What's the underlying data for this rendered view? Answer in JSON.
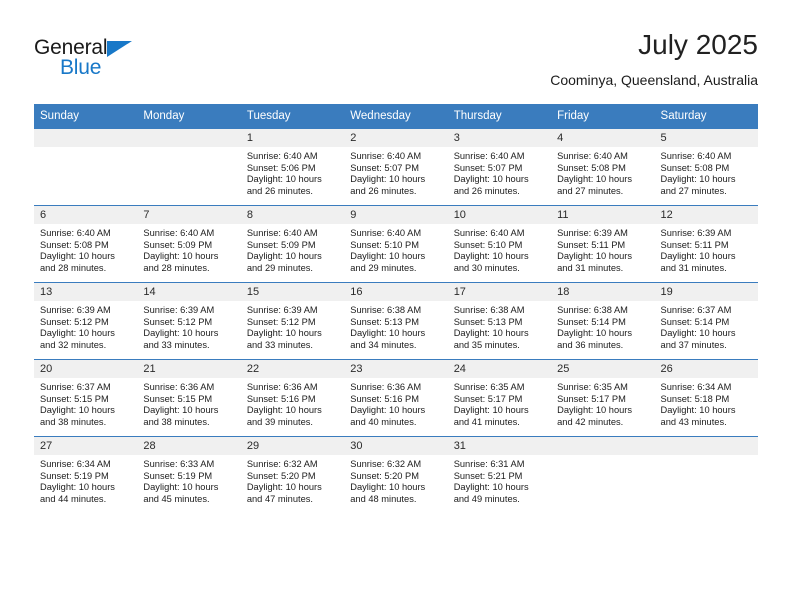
{
  "brand": {
    "name_line1": "General",
    "name_line2": "Blue",
    "accent_color": "#1878c8"
  },
  "header": {
    "month_title": "July 2025",
    "location": "Coominya, Queensland, Australia"
  },
  "calendar": {
    "header_bg": "#3a7cbe",
    "daynum_band_bg": "#f0f0f0",
    "weekday_headers": [
      "Sunday",
      "Monday",
      "Tuesday",
      "Wednesday",
      "Thursday",
      "Friday",
      "Saturday"
    ],
    "weeks": [
      [
        {
          "day": "",
          "sunrise": "",
          "sunset": "",
          "daylight_line1": "",
          "daylight_line2": ""
        },
        {
          "day": "",
          "sunrise": "",
          "sunset": "",
          "daylight_line1": "",
          "daylight_line2": ""
        },
        {
          "day": "1",
          "sunrise": "Sunrise: 6:40 AM",
          "sunset": "Sunset: 5:06 PM",
          "daylight_line1": "Daylight: 10 hours",
          "daylight_line2": "and 26 minutes."
        },
        {
          "day": "2",
          "sunrise": "Sunrise: 6:40 AM",
          "sunset": "Sunset: 5:07 PM",
          "daylight_line1": "Daylight: 10 hours",
          "daylight_line2": "and 26 minutes."
        },
        {
          "day": "3",
          "sunrise": "Sunrise: 6:40 AM",
          "sunset": "Sunset: 5:07 PM",
          "daylight_line1": "Daylight: 10 hours",
          "daylight_line2": "and 26 minutes."
        },
        {
          "day": "4",
          "sunrise": "Sunrise: 6:40 AM",
          "sunset": "Sunset: 5:08 PM",
          "daylight_line1": "Daylight: 10 hours",
          "daylight_line2": "and 27 minutes."
        },
        {
          "day": "5",
          "sunrise": "Sunrise: 6:40 AM",
          "sunset": "Sunset: 5:08 PM",
          "daylight_line1": "Daylight: 10 hours",
          "daylight_line2": "and 27 minutes."
        }
      ],
      [
        {
          "day": "6",
          "sunrise": "Sunrise: 6:40 AM",
          "sunset": "Sunset: 5:08 PM",
          "daylight_line1": "Daylight: 10 hours",
          "daylight_line2": "and 28 minutes."
        },
        {
          "day": "7",
          "sunrise": "Sunrise: 6:40 AM",
          "sunset": "Sunset: 5:09 PM",
          "daylight_line1": "Daylight: 10 hours",
          "daylight_line2": "and 28 minutes."
        },
        {
          "day": "8",
          "sunrise": "Sunrise: 6:40 AM",
          "sunset": "Sunset: 5:09 PM",
          "daylight_line1": "Daylight: 10 hours",
          "daylight_line2": "and 29 minutes."
        },
        {
          "day": "9",
          "sunrise": "Sunrise: 6:40 AM",
          "sunset": "Sunset: 5:10 PM",
          "daylight_line1": "Daylight: 10 hours",
          "daylight_line2": "and 29 minutes."
        },
        {
          "day": "10",
          "sunrise": "Sunrise: 6:40 AM",
          "sunset": "Sunset: 5:10 PM",
          "daylight_line1": "Daylight: 10 hours",
          "daylight_line2": "and 30 minutes."
        },
        {
          "day": "11",
          "sunrise": "Sunrise: 6:39 AM",
          "sunset": "Sunset: 5:11 PM",
          "daylight_line1": "Daylight: 10 hours",
          "daylight_line2": "and 31 minutes."
        },
        {
          "day": "12",
          "sunrise": "Sunrise: 6:39 AM",
          "sunset": "Sunset: 5:11 PM",
          "daylight_line1": "Daylight: 10 hours",
          "daylight_line2": "and 31 minutes."
        }
      ],
      [
        {
          "day": "13",
          "sunrise": "Sunrise: 6:39 AM",
          "sunset": "Sunset: 5:12 PM",
          "daylight_line1": "Daylight: 10 hours",
          "daylight_line2": "and 32 minutes."
        },
        {
          "day": "14",
          "sunrise": "Sunrise: 6:39 AM",
          "sunset": "Sunset: 5:12 PM",
          "daylight_line1": "Daylight: 10 hours",
          "daylight_line2": "and 33 minutes."
        },
        {
          "day": "15",
          "sunrise": "Sunrise: 6:39 AM",
          "sunset": "Sunset: 5:12 PM",
          "daylight_line1": "Daylight: 10 hours",
          "daylight_line2": "and 33 minutes."
        },
        {
          "day": "16",
          "sunrise": "Sunrise: 6:38 AM",
          "sunset": "Sunset: 5:13 PM",
          "daylight_line1": "Daylight: 10 hours",
          "daylight_line2": "and 34 minutes."
        },
        {
          "day": "17",
          "sunrise": "Sunrise: 6:38 AM",
          "sunset": "Sunset: 5:13 PM",
          "daylight_line1": "Daylight: 10 hours",
          "daylight_line2": "and 35 minutes."
        },
        {
          "day": "18",
          "sunrise": "Sunrise: 6:38 AM",
          "sunset": "Sunset: 5:14 PM",
          "daylight_line1": "Daylight: 10 hours",
          "daylight_line2": "and 36 minutes."
        },
        {
          "day": "19",
          "sunrise": "Sunrise: 6:37 AM",
          "sunset": "Sunset: 5:14 PM",
          "daylight_line1": "Daylight: 10 hours",
          "daylight_line2": "and 37 minutes."
        }
      ],
      [
        {
          "day": "20",
          "sunrise": "Sunrise: 6:37 AM",
          "sunset": "Sunset: 5:15 PM",
          "daylight_line1": "Daylight: 10 hours",
          "daylight_line2": "and 38 minutes."
        },
        {
          "day": "21",
          "sunrise": "Sunrise: 6:36 AM",
          "sunset": "Sunset: 5:15 PM",
          "daylight_line1": "Daylight: 10 hours",
          "daylight_line2": "and 38 minutes."
        },
        {
          "day": "22",
          "sunrise": "Sunrise: 6:36 AM",
          "sunset": "Sunset: 5:16 PM",
          "daylight_line1": "Daylight: 10 hours",
          "daylight_line2": "and 39 minutes."
        },
        {
          "day": "23",
          "sunrise": "Sunrise: 6:36 AM",
          "sunset": "Sunset: 5:16 PM",
          "daylight_line1": "Daylight: 10 hours",
          "daylight_line2": "and 40 minutes."
        },
        {
          "day": "24",
          "sunrise": "Sunrise: 6:35 AM",
          "sunset": "Sunset: 5:17 PM",
          "daylight_line1": "Daylight: 10 hours",
          "daylight_line2": "and 41 minutes."
        },
        {
          "day": "25",
          "sunrise": "Sunrise: 6:35 AM",
          "sunset": "Sunset: 5:17 PM",
          "daylight_line1": "Daylight: 10 hours",
          "daylight_line2": "and 42 minutes."
        },
        {
          "day": "26",
          "sunrise": "Sunrise: 6:34 AM",
          "sunset": "Sunset: 5:18 PM",
          "daylight_line1": "Daylight: 10 hours",
          "daylight_line2": "and 43 minutes."
        }
      ],
      [
        {
          "day": "27",
          "sunrise": "Sunrise: 6:34 AM",
          "sunset": "Sunset: 5:19 PM",
          "daylight_line1": "Daylight: 10 hours",
          "daylight_line2": "and 44 minutes."
        },
        {
          "day": "28",
          "sunrise": "Sunrise: 6:33 AM",
          "sunset": "Sunset: 5:19 PM",
          "daylight_line1": "Daylight: 10 hours",
          "daylight_line2": "and 45 minutes."
        },
        {
          "day": "29",
          "sunrise": "Sunrise: 6:32 AM",
          "sunset": "Sunset: 5:20 PM",
          "daylight_line1": "Daylight: 10 hours",
          "daylight_line2": "and 47 minutes."
        },
        {
          "day": "30",
          "sunrise": "Sunrise: 6:32 AM",
          "sunset": "Sunset: 5:20 PM",
          "daylight_line1": "Daylight: 10 hours",
          "daylight_line2": "and 48 minutes."
        },
        {
          "day": "31",
          "sunrise": "Sunrise: 6:31 AM",
          "sunset": "Sunset: 5:21 PM",
          "daylight_line1": "Daylight: 10 hours",
          "daylight_line2": "and 49 minutes."
        },
        {
          "day": "",
          "sunrise": "",
          "sunset": "",
          "daylight_line1": "",
          "daylight_line2": ""
        },
        {
          "day": "",
          "sunrise": "",
          "sunset": "",
          "daylight_line1": "",
          "daylight_line2": ""
        }
      ]
    ]
  }
}
